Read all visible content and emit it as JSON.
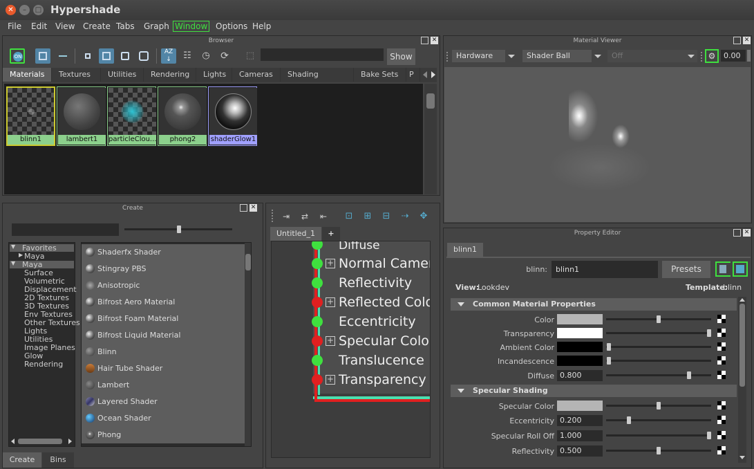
{
  "window": {
    "title": "Hypershade"
  },
  "menu": [
    "File",
    "Edit",
    "View",
    "Create",
    "Tabs",
    "Graph",
    "Window",
    "Options",
    "Help"
  ],
  "browser": {
    "title": "Browser",
    "show_label": "Show",
    "tabs": [
      "Materials",
      "Textures",
      "Utilities",
      "Rendering",
      "Lights",
      "Cameras",
      "Shading Groups",
      "Bake Sets",
      "P"
    ],
    "swatches": [
      "blinn1",
      "lambert1",
      "particleClou...",
      "phong2",
      "shaderGlow1"
    ]
  },
  "material_viewer": {
    "title": "Material Viewer",
    "renderer": "Hardware",
    "geometry": "Shader Ball",
    "env": "Off",
    "exposure": "0.00"
  },
  "create": {
    "title": "Create",
    "tree": [
      "Favorites",
      "Maya",
      "Maya",
      "Surface",
      "Volumetric",
      "Displacement",
      "2D Textures",
      "3D Textures",
      "Env Textures",
      "Other Textures",
      "Lights",
      "Utilities",
      "Image Planes",
      "Glow",
      "Rendering"
    ],
    "shaders": [
      "Shaderfx Shader",
      "Stingray PBS",
      "Anisotropic",
      "Bifrost Aero Material",
      "Bifrost Foam Material",
      "Bifrost Liquid Material",
      "Blinn",
      "Hair Tube Shader",
      "Lambert",
      "Layered Shader",
      "Ocean Shader",
      "Phong"
    ],
    "bottom_tabs": [
      "Create",
      "Bins"
    ]
  },
  "graph": {
    "tab": "Untitled_1",
    "add_tab": "+",
    "attrs": [
      "Diffuse",
      "Normal Camer",
      "Reflectivity",
      "Reflected Colo",
      "Eccentricity",
      "Specular Color",
      "Translucence",
      "Transparency"
    ]
  },
  "property_editor": {
    "title": "Property Editor",
    "tab": "blinn1",
    "node_label": "blinn:",
    "node_name": "blinn1",
    "presets": "Presets",
    "view_label": "View:",
    "view_value": "Lookdev",
    "template_label": "Template:",
    "template_value": "blinn",
    "section1": "Common Material Properties",
    "section2": "Specular Shading",
    "color_label": "Color",
    "transparency_label": "Transparency",
    "ambient_label": "Ambient Color",
    "incandescence_label": "Incandescence",
    "diffuse_label": "Diffuse",
    "diffuse_value": "0.800",
    "spec_color_label": "Specular Color",
    "eccentricity_label": "Eccentricity",
    "eccentricity_value": "0.200",
    "rolloff_label": "Specular Roll Off",
    "rolloff_value": "1.000",
    "reflectivity_label": "Reflectivity",
    "reflectivity_value": "0.500"
  }
}
